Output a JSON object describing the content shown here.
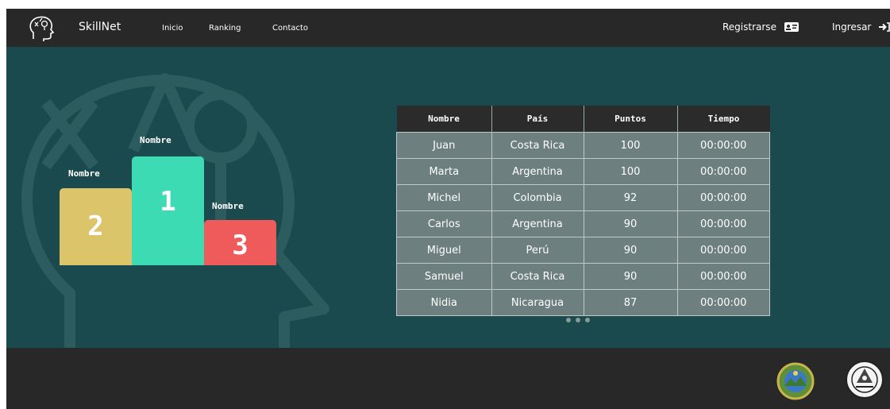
{
  "nav": {
    "brand": "SkillNet",
    "links": [
      "Inicio",
      "Ranking",
      "Contacto"
    ],
    "register_label": "Registrarse",
    "login_label": "Ingresar"
  },
  "podium": {
    "first": {
      "label": "Nombre",
      "place": "1",
      "color": "#3ddbb4"
    },
    "second": {
      "label": "Nombre",
      "place": "2",
      "color": "#dbc46a"
    },
    "third": {
      "label": "Nombre",
      "place": "3",
      "color": "#ef5a5a"
    }
  },
  "table": {
    "headers": [
      "Nombre",
      "País",
      "Puntos",
      "Tiempo"
    ],
    "rows": [
      [
        "Juan",
        "Costa Rica",
        "100",
        "00:00:00"
      ],
      [
        "Marta",
        "Argentina",
        "100",
        "00:00:00"
      ],
      [
        "Michel",
        "Colombia",
        "92",
        "00:00:00"
      ],
      [
        "Carlos",
        "Argentina",
        "90",
        "00:00:00"
      ],
      [
        "Miguel",
        "Perú",
        "90",
        "00:00:00"
      ],
      [
        "Samuel",
        "Costa Rica",
        "90",
        "00:00:00"
      ],
      [
        "Nidia",
        "Nicaragua",
        "87",
        "00:00:00"
      ]
    ]
  },
  "icons": {
    "logo": "head-bulb-logo-icon",
    "register": "id-card-icon",
    "login": "sign-in-icon",
    "seal_left": "government-seal-icon",
    "seal_right": "university-seal-icon"
  },
  "colors": {
    "nav_bg": "#282828",
    "hero_bg": "#1a4a4e",
    "table_header_bg": "#2b2b2b",
    "table_cell_bg": "#6e7f80"
  }
}
